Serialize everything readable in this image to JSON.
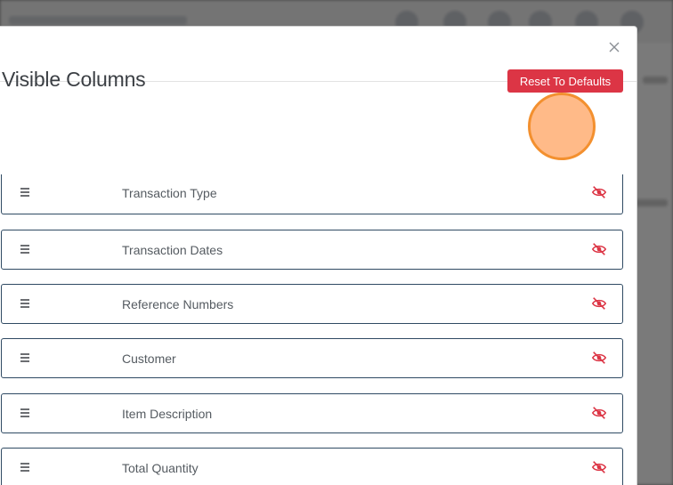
{
  "modal": {
    "title": "Visible Columns",
    "reset_label": "Reset To Defaults"
  },
  "columns": [
    {
      "label": "Transaction Type"
    },
    {
      "label": "Transaction Dates"
    },
    {
      "label": "Reference Numbers"
    },
    {
      "label": "Customer"
    },
    {
      "label": "Item Description"
    },
    {
      "label": "Total Quantity"
    }
  ],
  "icons": {
    "close": "close-icon",
    "handle": "drag-handle-icon",
    "visibility": "eye-off-icon"
  },
  "colors": {
    "accent_danger": "#dc3545",
    "border": "#2f4a63",
    "click_indicator": "#f3902f"
  }
}
